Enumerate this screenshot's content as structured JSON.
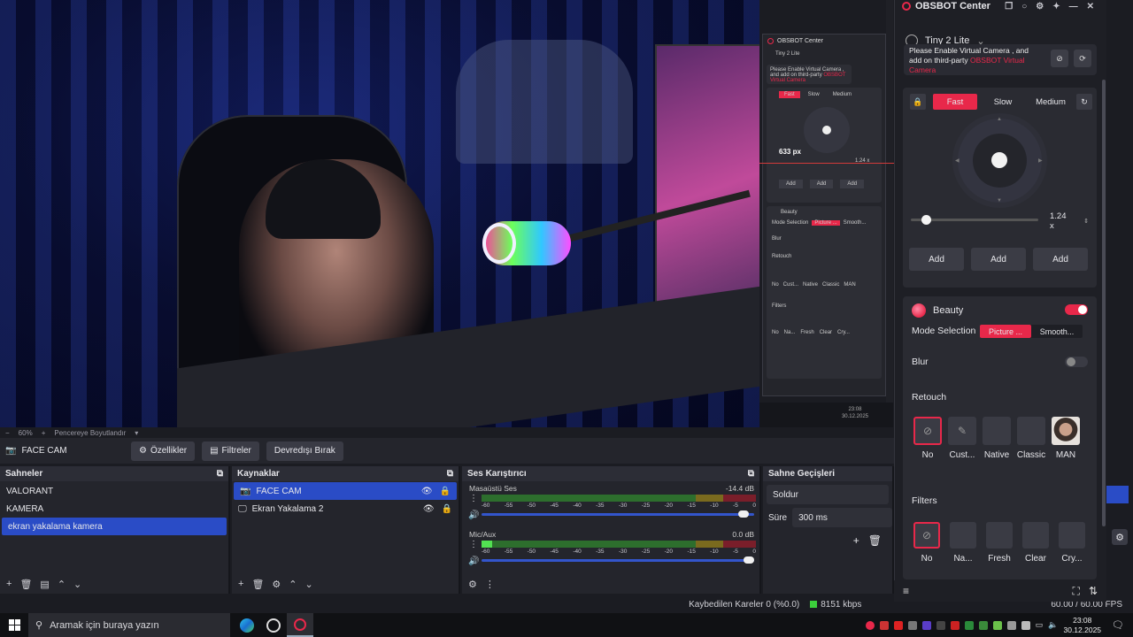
{
  "preview": {
    "zoom": "60%",
    "fit_label": "Pencereye Boyutlandır"
  },
  "mini_window": {
    "title": "OBSBOT Center",
    "device": "Tiny 2 Lite",
    "vcam_text": "Please Enable Virtual Camera , and add on third-party",
    "vcam_warn": "OBSBOT Virtual Camera",
    "speeds": [
      "Fast",
      "Slow",
      "Medium"
    ],
    "px_readout": "633 px",
    "zoom": "1.24 x",
    "add_labels": [
      "Add",
      "Add",
      "Add"
    ],
    "beauty": "Beauty",
    "mode_selection": "Mode Selection",
    "modes": [
      "Picture ...",
      "Smooth..."
    ],
    "blur": "Blur",
    "retouch": "Retouch",
    "retouch_items": [
      "No",
      "Cust...",
      "Native",
      "Classic",
      "MAN"
    ],
    "filters": "Filters",
    "filter_items": [
      "No",
      "Na...",
      "Fresh",
      "Clear",
      "Cry..."
    ],
    "clock_time": "23:08",
    "clock_date": "30.12.2025"
  },
  "source_bar": {
    "source_name": "FACE CAM",
    "properties": "Özellikler",
    "filters": "Filtreler",
    "deactivate": "Devredışı Bırak"
  },
  "scenes": {
    "title": "Sahneler",
    "items": [
      "VALORANT",
      "KAMERA",
      "ekran yakalama kamera"
    ]
  },
  "sources": {
    "title": "Kaynaklar",
    "items": [
      "FACE CAM",
      "Ekran Yakalama 2"
    ]
  },
  "mixer": {
    "title": "Ses Karıştırıcı",
    "tracks": [
      {
        "name": "Masaüstü Ses",
        "db": "-14.4 dB",
        "level": 0,
        "volume": 0.98
      },
      {
        "name": "Mic/Aux",
        "db": "0.0 dB",
        "level": 0.04,
        "volume": 1.0
      }
    ],
    "scale": [
      "-60",
      "-55",
      "-50",
      "-45",
      "-40",
      "-35",
      "-30",
      "-25",
      "-20",
      "-15",
      "-10",
      "-5",
      "0"
    ]
  },
  "transitions": {
    "title": "Sahne Geçişleri",
    "type": "Soldur",
    "duration_label": "Süre",
    "duration": "300 ms"
  },
  "status": {
    "dropped": "Kaybedilen Kareler 0 (%0.0)",
    "bitrate": "8151 kbps",
    "fps": "60.00 / 60.00 FPS"
  },
  "taskbar": {
    "search_placeholder": "Aramak için buraya yazın",
    "time": "23:08",
    "date": "30.12.2025"
  },
  "obsbot": {
    "title": "OBSBOT Center",
    "device": "Tiny 2 Lite",
    "vcam_text": "Please Enable Virtual Camera , and add on third-party",
    "vcam_warn": "OBSBOT Virtual Camera",
    "speeds": [
      "Fast",
      "Slow",
      "Medium"
    ],
    "zoom": "1.24 x",
    "zoom_level": 0.08,
    "add_labels": [
      "Add",
      "Add",
      "Add"
    ],
    "beauty": "Beauty",
    "mode_selection": "Mode Selection",
    "modes": [
      "Picture ...",
      "Smooth..."
    ],
    "blur": "Blur",
    "retouch": "Retouch",
    "retouch_items": [
      "No",
      "Cust...",
      "Native",
      "Classic",
      "MAN"
    ],
    "filters": "Filters",
    "filter_items": [
      "No",
      "Na...",
      "Fresh",
      "Clear",
      "Cry..."
    ],
    "accent": "#e8284a"
  }
}
